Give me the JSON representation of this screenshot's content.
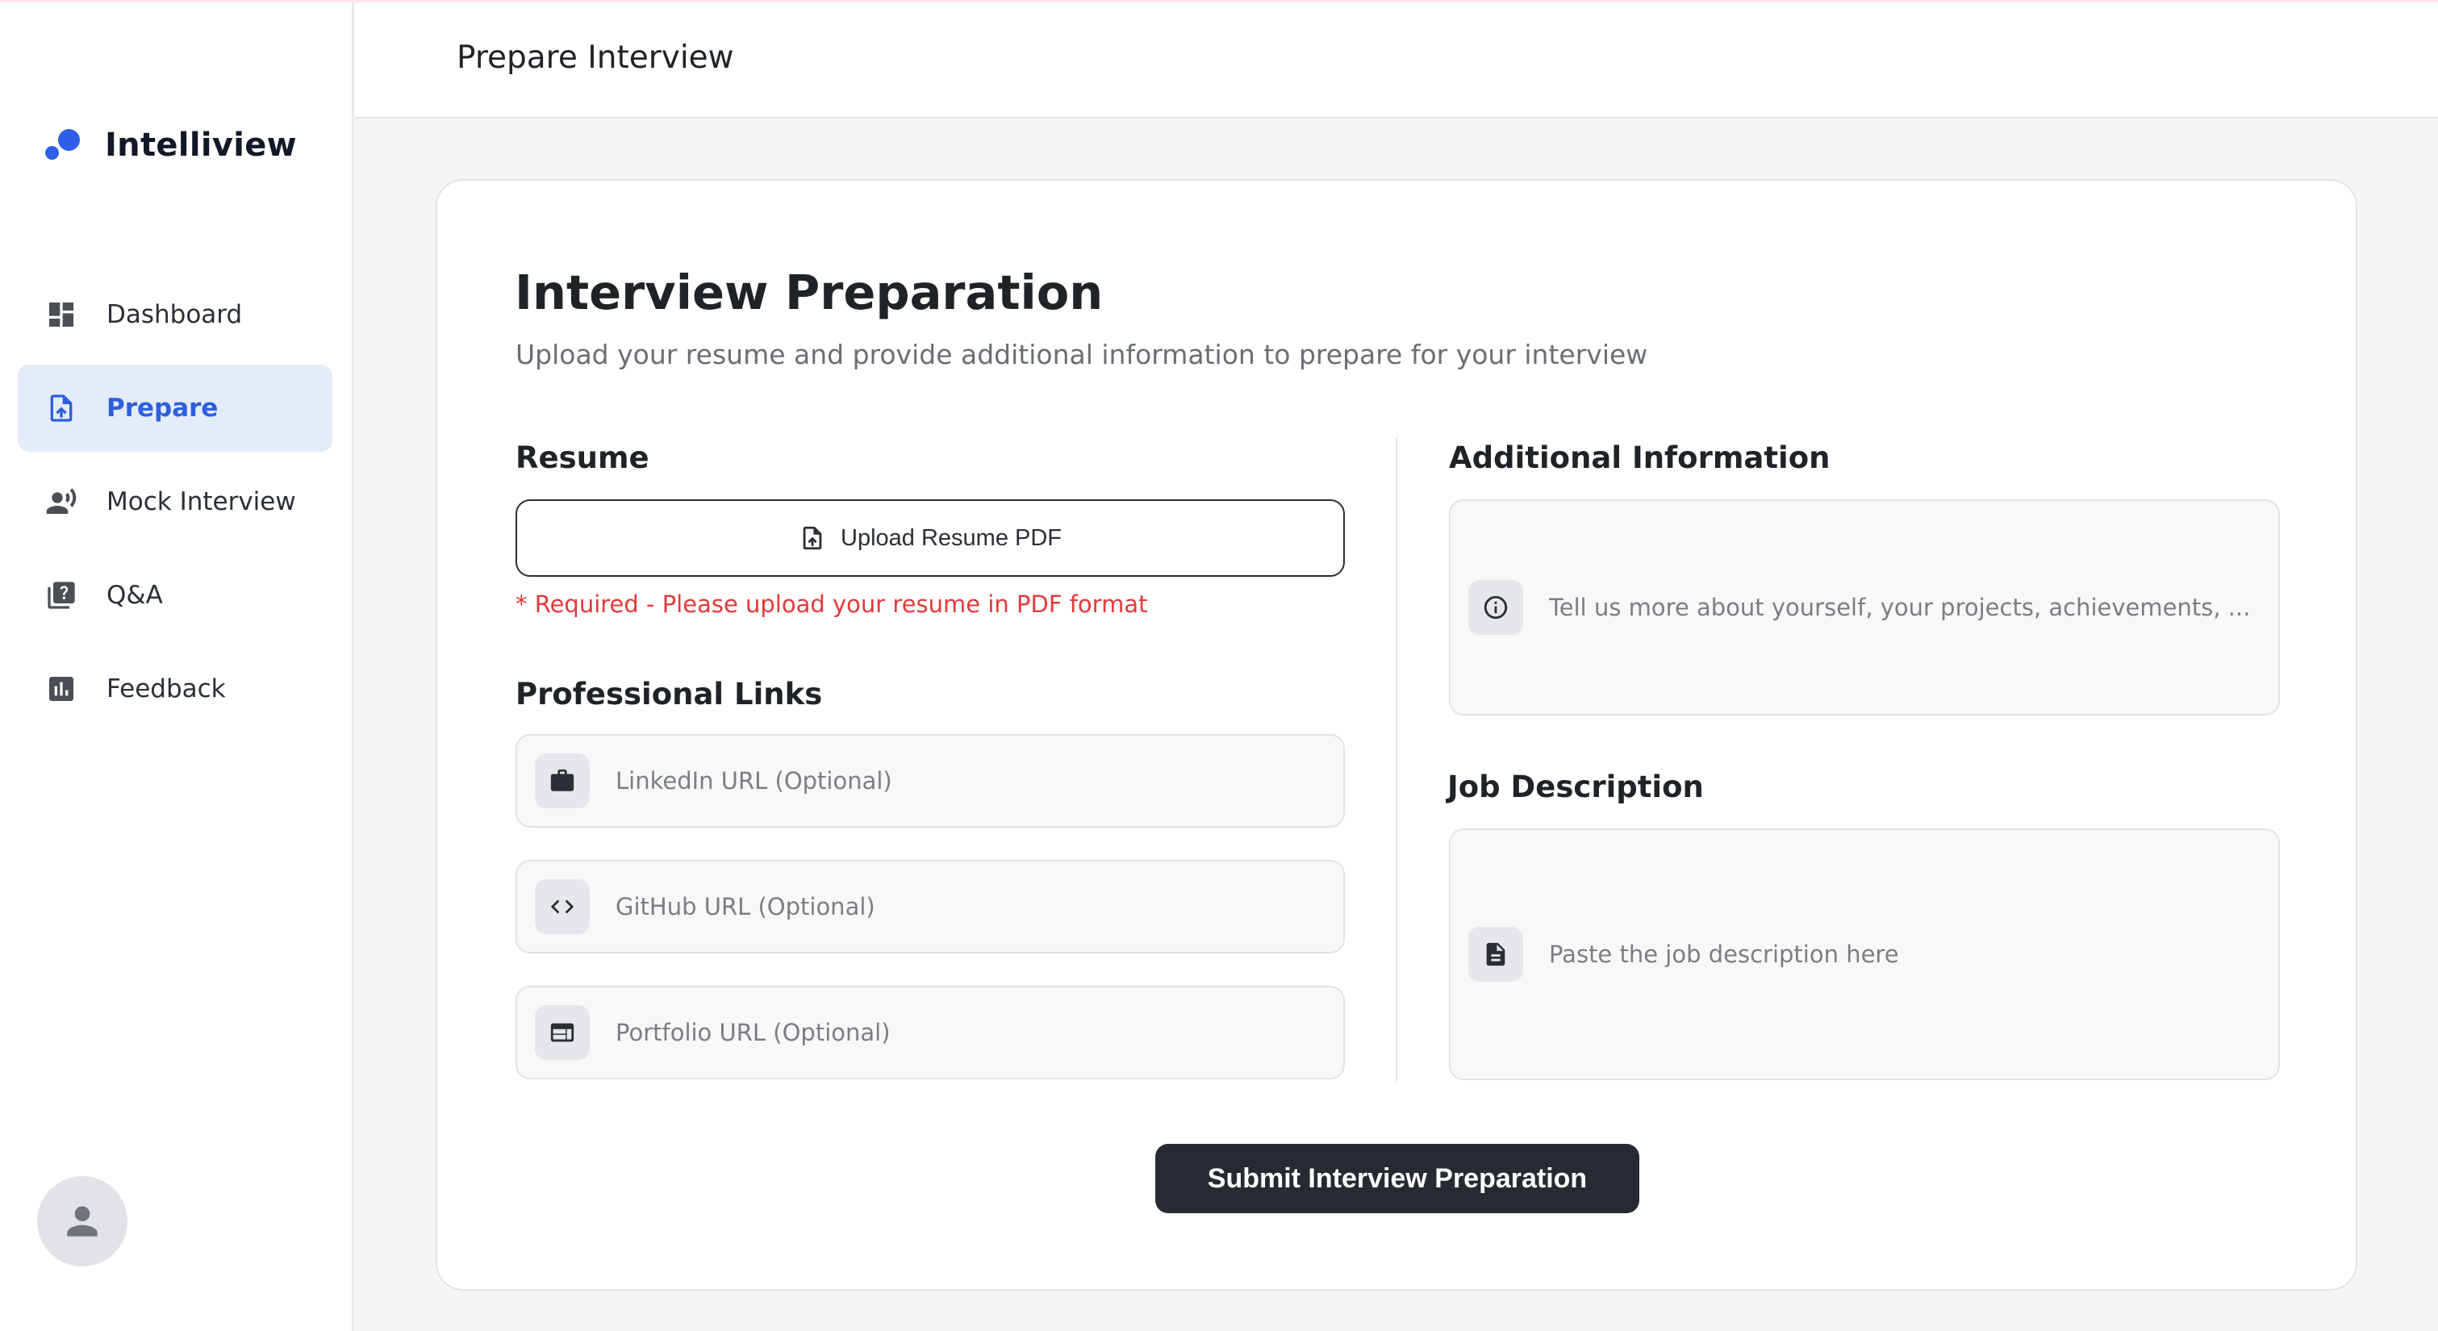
{
  "header": {
    "title": "Prepare Interview"
  },
  "brand": {
    "name": "Intelliview",
    "color": "#2f5fe8"
  },
  "sidebar": {
    "items": [
      {
        "label": "Dashboard",
        "icon": "dashboard-icon",
        "active": false
      },
      {
        "label": "Prepare",
        "icon": "upload-file-icon",
        "active": true
      },
      {
        "label": "Mock Interview",
        "icon": "speaking-person-icon",
        "active": false
      },
      {
        "label": "Q&A",
        "icon": "question-icon",
        "active": false
      },
      {
        "label": "Feedback",
        "icon": "bar-chart-icon",
        "active": false
      }
    ],
    "avatar_icon": "user-icon"
  },
  "main": {
    "title": "Interview Preparation",
    "subtitle": "Upload your resume and provide additional information to prepare for your interview",
    "resume": {
      "label": "Resume",
      "upload_label": "Upload Resume PDF",
      "required_note": "* Required - Please upload your resume in PDF format"
    },
    "links": {
      "label": "Professional Links",
      "linkedin_placeholder": "LinkedIn URL (Optional)",
      "github_placeholder": "GitHub URL (Optional)",
      "portfolio_placeholder": "Portfolio URL (Optional)"
    },
    "additional": {
      "label": "Additional Information",
      "placeholder": "Tell us more about yourself, your projects, achievements, ..."
    },
    "job": {
      "label": "Job Description",
      "placeholder": "Paste the job description here"
    },
    "submit_label": "Submit Interview Preparation"
  },
  "colors": {
    "accent": "#2f5fdd",
    "active_bg": "#e4ecfa",
    "error": "#e23a3a",
    "primary_button": "#262b33"
  }
}
